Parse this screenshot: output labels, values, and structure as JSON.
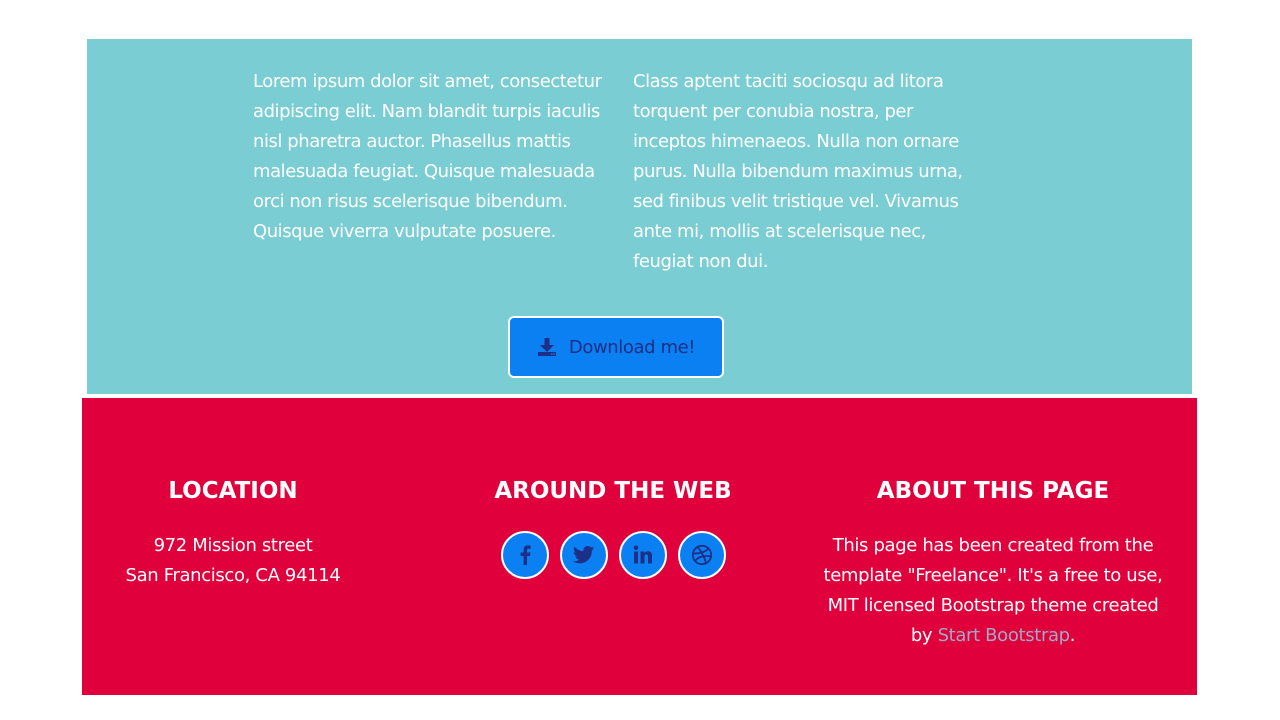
{
  "about": {
    "paragraph_left": "Lorem ipsum dolor sit amet, consectetur adipiscing elit. Nam blandit turpis iaculis nisl pharetra auctor. Phasellus mattis malesuada feugiat. Quisque malesuada orci non risus scelerisque bibendum. Quisque viverra vulputate posuere.",
    "paragraph_right": "Class aptent taciti sociosqu ad litora torquent per conubia nostra, per inceptos himenaeos. Nulla non ornare purus. Nulla bibendum maximus urna, sed finibus velit tristique vel. Vivamus ante mi, mollis at scelerisque nec, feugiat non dui.",
    "download_label": "Download me!",
    "download_icon": "download-icon",
    "background_color": "#79cdd3",
    "button_color": "#0a80f2"
  },
  "footer": {
    "background_color": "#e0003b",
    "location": {
      "heading": "LOCATION",
      "line1": "972 Mission street",
      "line2": "San Francisco, CA 94114"
    },
    "web": {
      "heading": "AROUND THE WEB",
      "social": [
        {
          "name": "facebook",
          "icon": "facebook-icon"
        },
        {
          "name": "twitter",
          "icon": "twitter-icon"
        },
        {
          "name": "linkedin",
          "icon": "linkedin-icon"
        },
        {
          "name": "dribbble",
          "icon": "dribbble-icon"
        }
      ]
    },
    "about_page": {
      "heading": "ABOUT THIS PAGE",
      "text_before": "This page has been created from the template \"Freelance\". It's a free to use, MIT licensed Bootstrap theme created by ",
      "link_text": "Start Bootstrap",
      "text_after": "."
    }
  }
}
